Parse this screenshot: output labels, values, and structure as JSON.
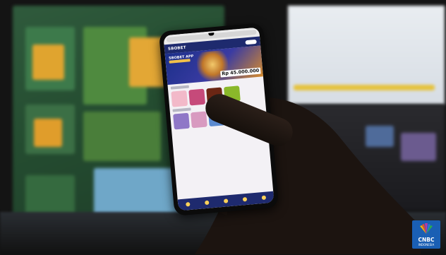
{
  "phone_screen": {
    "brand": "SBOBET",
    "banner_title": "SBOBET APP",
    "jackpot_amount": "Rp 45.000.000"
  },
  "logo": {
    "text": "CNBC",
    "subtext": "INDONESIA"
  },
  "colors": {
    "site_nav": "#1e2a6e",
    "monitor_green": "#2f5a3c",
    "logo_blue": "#1a5fb4"
  }
}
